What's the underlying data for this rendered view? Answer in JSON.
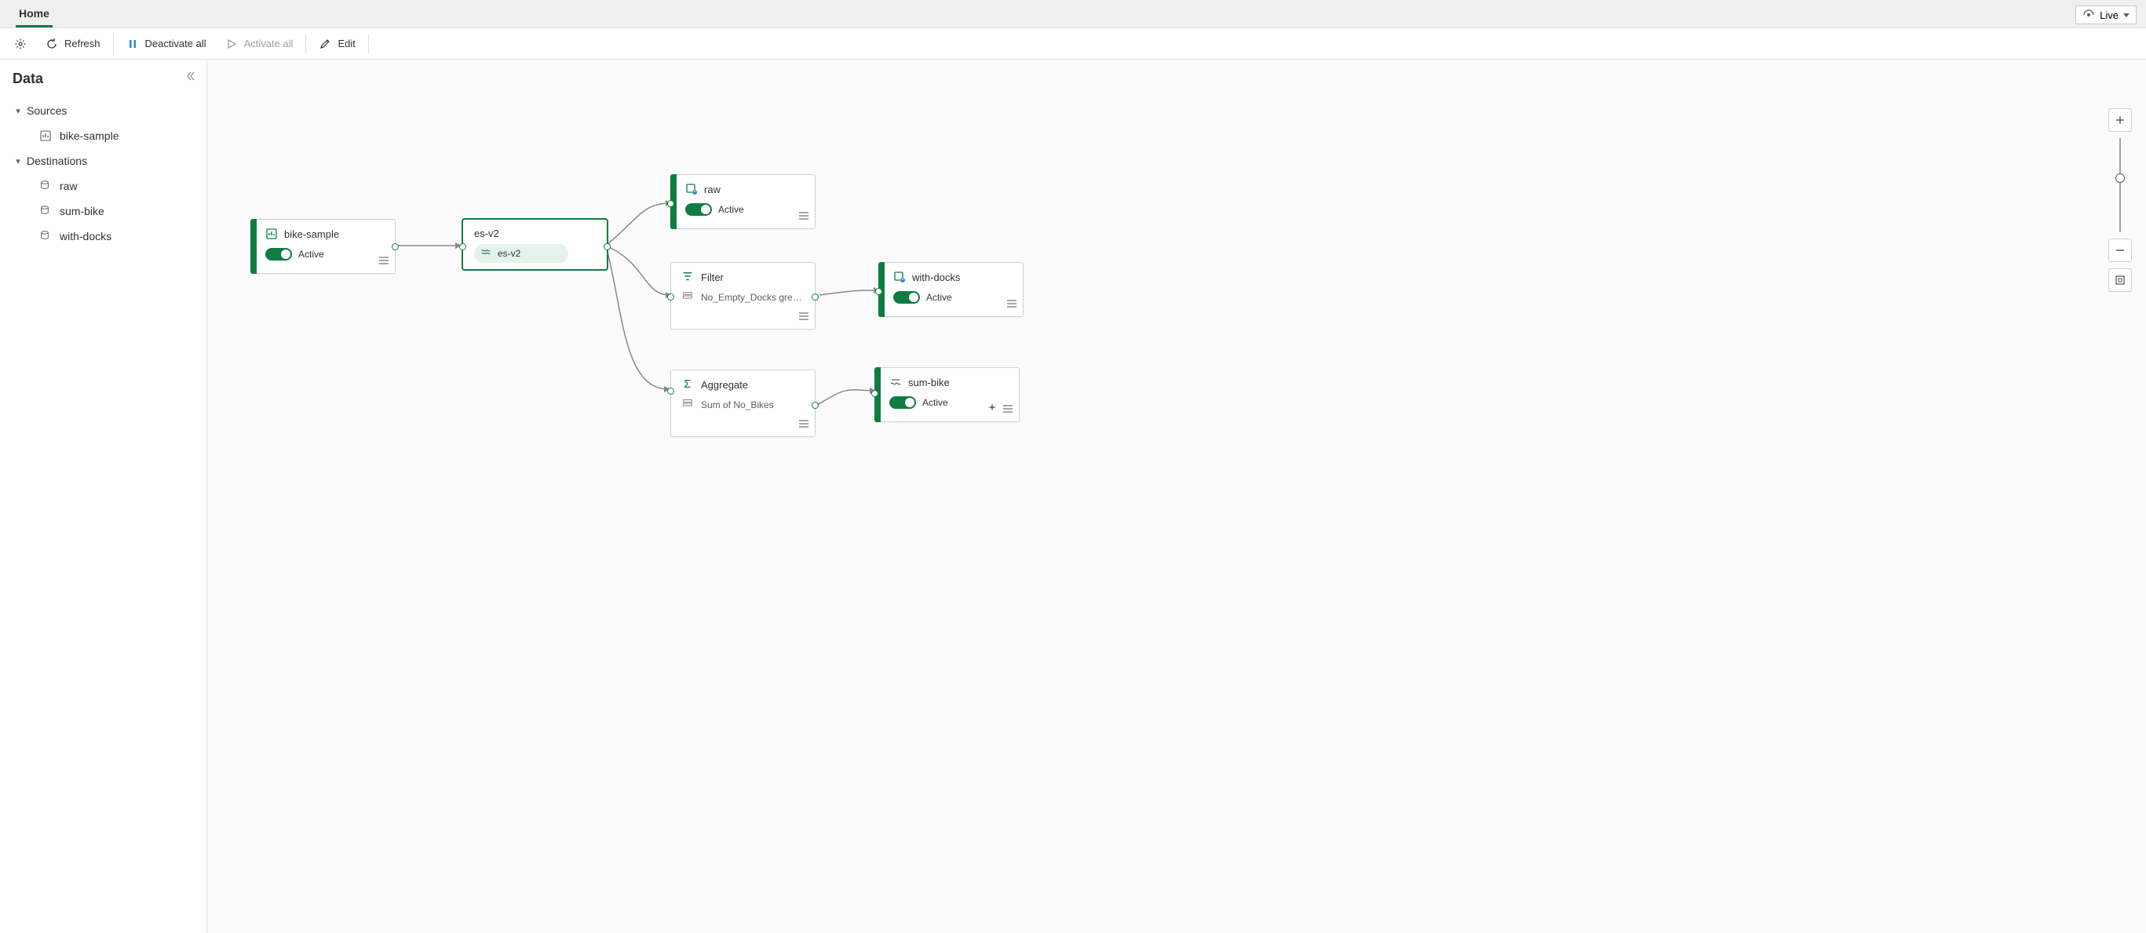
{
  "tabs": {
    "home": "Home"
  },
  "live_button": "Live",
  "cmd": {
    "refresh": "Refresh",
    "deactivate_all": "Deactivate all",
    "activate_all": "Activate all",
    "edit": "Edit"
  },
  "sidebar": {
    "title": "Data",
    "sections": {
      "sources": "Sources",
      "destinations": "Destinations"
    },
    "sources": [
      {
        "label": "bike-sample"
      }
    ],
    "destinations": [
      {
        "label": "raw"
      },
      {
        "label": "sum-bike"
      },
      {
        "label": "with-docks"
      }
    ]
  },
  "status": {
    "active": "Active"
  },
  "nodes": {
    "bike_sample": {
      "title": "bike-sample"
    },
    "es_v2": {
      "title": "es-v2",
      "pill": "es-v2"
    },
    "raw": {
      "title": "raw"
    },
    "filter": {
      "title": "Filter",
      "detail": "No_Empty_Docks greater t..."
    },
    "aggregate": {
      "title": "Aggregate",
      "detail": "Sum of No_Bikes"
    },
    "with_docks": {
      "title": "with-docks"
    },
    "sum_bike": {
      "title": "sum-bike"
    }
  }
}
